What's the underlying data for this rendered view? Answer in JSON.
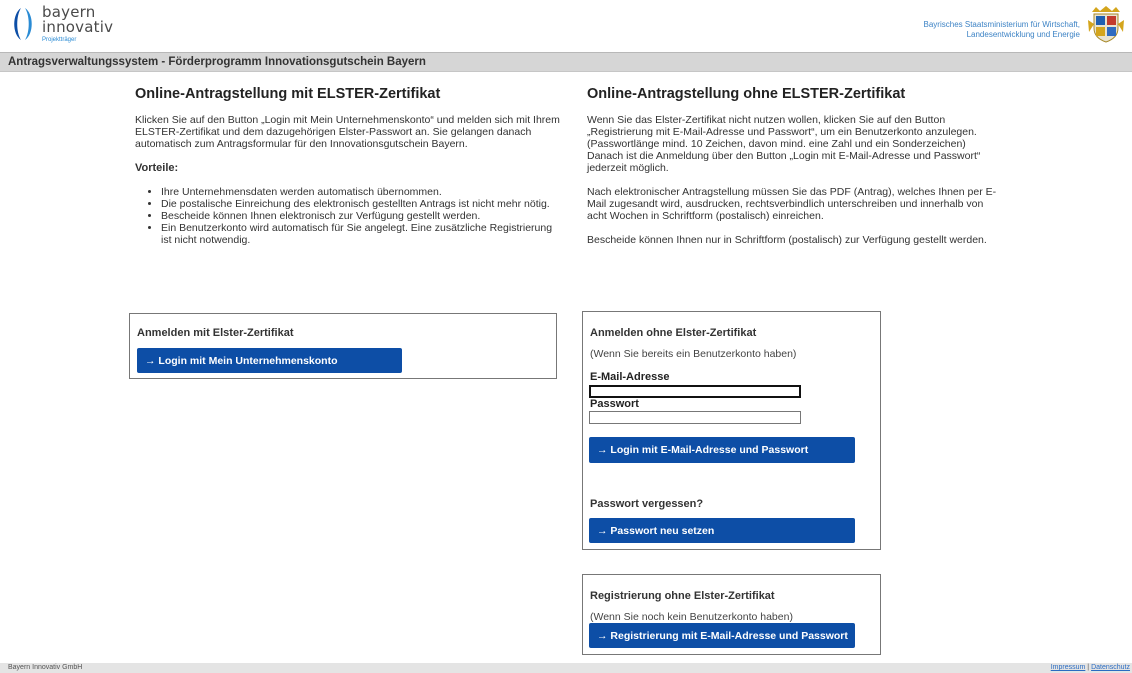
{
  "header": {
    "logo": {
      "line1": "bayern",
      "line2": "innovativ",
      "sub": "Projektträger"
    },
    "ministry_line1": "Bayrisches Staatsministerium für Wirtschaft,",
    "ministry_line2": "Landesentwicklung und Energie"
  },
  "titlebar": {
    "text": "Antragsverwaltungssystem - Förderprogramm Innovationsgutschein Bayern"
  },
  "left": {
    "heading": "Online-Antragstellung mit ELSTER-Zertifikat",
    "intro": "Klicken Sie auf den Button „Login mit Mein Unternehmenskonto“ und melden sich mit Ihrem ELSTER-Zertifikat und dem dazugehörigen Elster-Passwort an. Sie gelangen danach automatisch zum Antragsformular für den Innovationsgutschein Bayern.",
    "vorteile_label": "Vorteile:",
    "vorteile": [
      "Ihre Unternehmensdaten werden automatisch übernommen.",
      "Die postalische Einreichung des elektronisch gestellten Antrags ist nicht mehr nötig.",
      "Bescheide können Ihnen elektronisch zur Verfügung gestellt werden.",
      "Ein Benutzerkonto wird automatisch für Sie angelegt. Eine zusätzliche Registrierung ist nicht notwendig."
    ]
  },
  "right": {
    "heading": "Online-Antragstellung ohne ELSTER-Zertifikat",
    "p1": "Wenn Sie das Elster-Zertifikat nicht nutzen wollen, klicken Sie auf den Button „Registrierung mit E-Mail-Adresse und Passwort“, um ein Benutzerkonto anzulegen. (Passwortlänge mind. 10 Zeichen, davon mind. eine Zahl und ein Sonderzeichen) Danach ist die Anmeldung über den Button „Login mit E-Mail-Adresse und Passwort“ jederzeit möglich.",
    "p2": "Nach elektronischer Antragstellung müssen Sie das PDF (Antrag), welches Ihnen per E-Mail zugesandt wird, ausdrucken, rechtsverbindlich unterschreiben und innerhalb von acht Wochen in Schriftform (postalisch) einreichen.",
    "p3": "Bescheide können Ihnen nur in Schriftform (postalisch) zur Verfügung gestellt werden."
  },
  "elster_box": {
    "title": "Anmelden mit Elster-Zertifikat",
    "button": "→ Login mit Mein Unternehmenskonto"
  },
  "login_box": {
    "title": "Anmelden ohne Elster-Zertifikat",
    "hint": "(Wenn Sie bereits ein Benutzerkonto haben)",
    "email_label": "E-Mail-Adresse",
    "email_value": "",
    "password_label": "Passwort",
    "password_value": "",
    "login_button": "→ Login mit E-Mail-Adresse und Passwort",
    "forgot_label": "Passwort vergessen?",
    "reset_button": "→ Passwort neu setzen"
  },
  "register_box": {
    "title": "Registrierung ohne Elster-Zertifikat",
    "hint": "(Wenn Sie noch kein Benutzerkonto haben)",
    "button": "→ Registrierung mit E-Mail-Adresse und Passwort"
  },
  "footer": {
    "company": "Bayern Innovativ GmbH",
    "impressum": "Impressum",
    "separator": "|",
    "datenschutz": "Datenschutz"
  },
  "colors": {
    "button": "#0d4ea6",
    "titlebar": "#d6d6d6",
    "ministry_text": "#3d83c5"
  }
}
